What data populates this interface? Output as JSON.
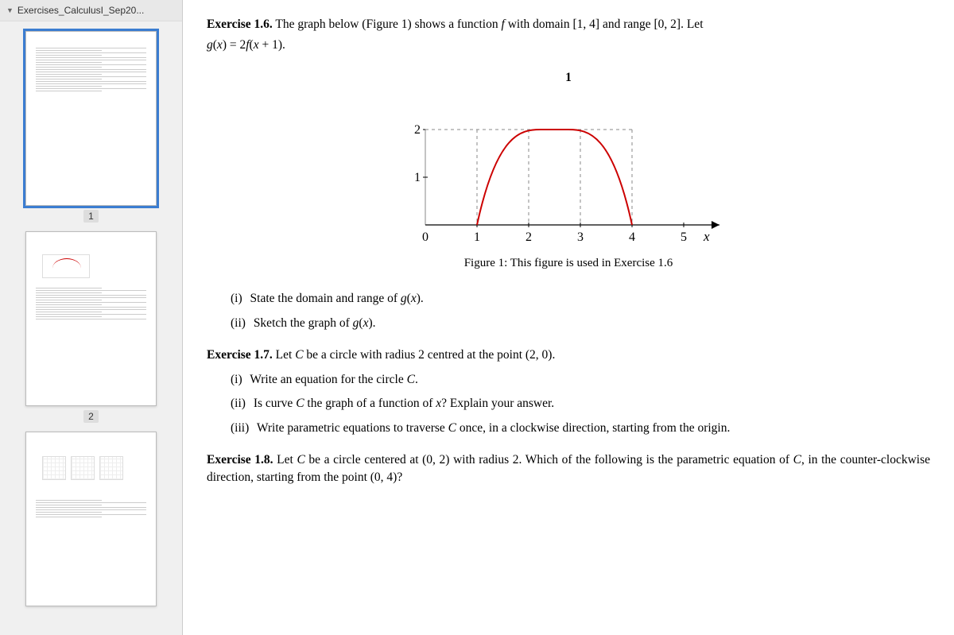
{
  "sidebar": {
    "doc_name": "Exercises_CalculusI_Sep20...",
    "thumbs": [
      {
        "num": "1",
        "selected": true
      },
      {
        "num": "2",
        "selected": false
      },
      {
        "num": "",
        "selected": false
      }
    ]
  },
  "ex16": {
    "num": "Exercise 1.6.",
    "text_a": " The graph below (Figure 1) shows a function ",
    "text_b": " with domain ",
    "domain": "[1, 4]",
    "text_c": " and range ",
    "range": "[0, 2]",
    "text_d": ". Let ",
    "gdef": "g(x) = 2f(x + 1).",
    "i_label": "(i)",
    "i_text": "State the domain and range of g(x).",
    "ii_label": "(ii)",
    "ii_text": "Sketch the graph of g(x)."
  },
  "figure": {
    "caption": "Figure 1: This figure is used in Exercise 1.6",
    "title_marker": "1",
    "y_ticks": [
      "1",
      "2"
    ],
    "x_ticks": [
      "0",
      "1",
      "2",
      "3",
      "4",
      "5"
    ],
    "x_label": "x"
  },
  "chart_data": {
    "type": "line",
    "title": "1",
    "xlabel": "x",
    "ylabel": "",
    "xlim": [
      0,
      5.5
    ],
    "ylim": [
      0,
      2.4
    ],
    "x_ticks": [
      0,
      1,
      2,
      3,
      4,
      5
    ],
    "y_ticks": [
      1,
      2
    ],
    "series": [
      {
        "name": "f",
        "color": "#c00",
        "x": [
          1.0,
          1.3,
          1.6,
          1.9,
          2.2,
          2.5,
          2.8,
          3.1,
          3.4,
          3.7,
          4.0
        ],
        "values": [
          0.0,
          0.95,
          1.55,
          1.9,
          2.0,
          2.0,
          2.0,
          1.9,
          1.55,
          0.95,
          0.0
        ]
      }
    ]
  },
  "ex17": {
    "num": "Exercise 1.7.",
    "text_a": " Let ",
    "text_b": " be a circle with radius 2 centred at the point ",
    "point": "(2, 0)",
    "text_c": ".",
    "i_label": "(i)",
    "i_text": "Write an equation for the circle C.",
    "ii_label": "(ii)",
    "ii_text_a": "Is curve ",
    "ii_text_b": " the graph of a function of ",
    "ii_text_c": "? Explain your answer.",
    "iii_label": "(iii)",
    "iii_text": "Write parametric equations to traverse C once, in a clockwise direction, starting from the origin."
  },
  "ex18": {
    "num": "Exercise 1.8.",
    "text_a": " Let ",
    "text_b": " be a circle centered at ",
    "point1": "(0, 2)",
    "text_c": " with radius 2.  Which of the following is the parametric equation of ",
    "text_d": ", in the counter-clockwise direction, starting from the point ",
    "point2": "(0, 4)",
    "text_e": "?"
  }
}
